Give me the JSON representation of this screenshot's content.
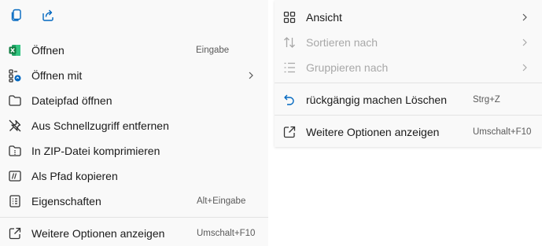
{
  "left_menu": {
    "toolbar": [
      "copy-icon",
      "share-icon"
    ],
    "items": [
      {
        "label": "Öffnen",
        "shortcut": "Eingabe",
        "icon": "excel-icon"
      },
      {
        "label": "Öffnen mit",
        "shortcut": "",
        "icon": "open-with-icon",
        "submenu": true
      },
      {
        "label": "Dateipfad öffnen",
        "shortcut": "",
        "icon": "folder-icon"
      },
      {
        "label": "Aus Schnellzugriff entfernen",
        "shortcut": "",
        "icon": "unpin-icon"
      },
      {
        "label": "In ZIP-Datei komprimieren",
        "shortcut": "",
        "icon": "zip-icon"
      },
      {
        "label": "Als Pfad kopieren",
        "shortcut": "",
        "icon": "copy-path-icon"
      },
      {
        "label": "Eigenschaften",
        "shortcut": "Alt+Eingabe",
        "icon": "properties-icon"
      },
      {
        "label": "Weitere Optionen anzeigen",
        "shortcut": "Umschalt+F10",
        "icon": "more-options-icon"
      }
    ]
  },
  "right_menu": {
    "items": [
      {
        "label": "Ansicht",
        "icon": "view-grid-icon",
        "submenu": true,
        "disabled": false
      },
      {
        "label": "Sortieren nach",
        "icon": "sort-icon",
        "submenu": true,
        "disabled": true
      },
      {
        "label": "Gruppieren nach",
        "icon": "group-icon",
        "submenu": true,
        "disabled": true
      },
      {
        "label": "rückgängig machen Löschen",
        "shortcut": "Strg+Z",
        "icon": "undo-icon"
      },
      {
        "label": "Weitere Optionen anzeigen",
        "shortcut": "Umschalt+F10",
        "icon": "more-options-icon"
      }
    ]
  },
  "colors": {
    "accent": "#0067c0",
    "excel_green": "#107c41",
    "menu_bg": "#f9f9f9",
    "separator": "#e3e3e3"
  }
}
